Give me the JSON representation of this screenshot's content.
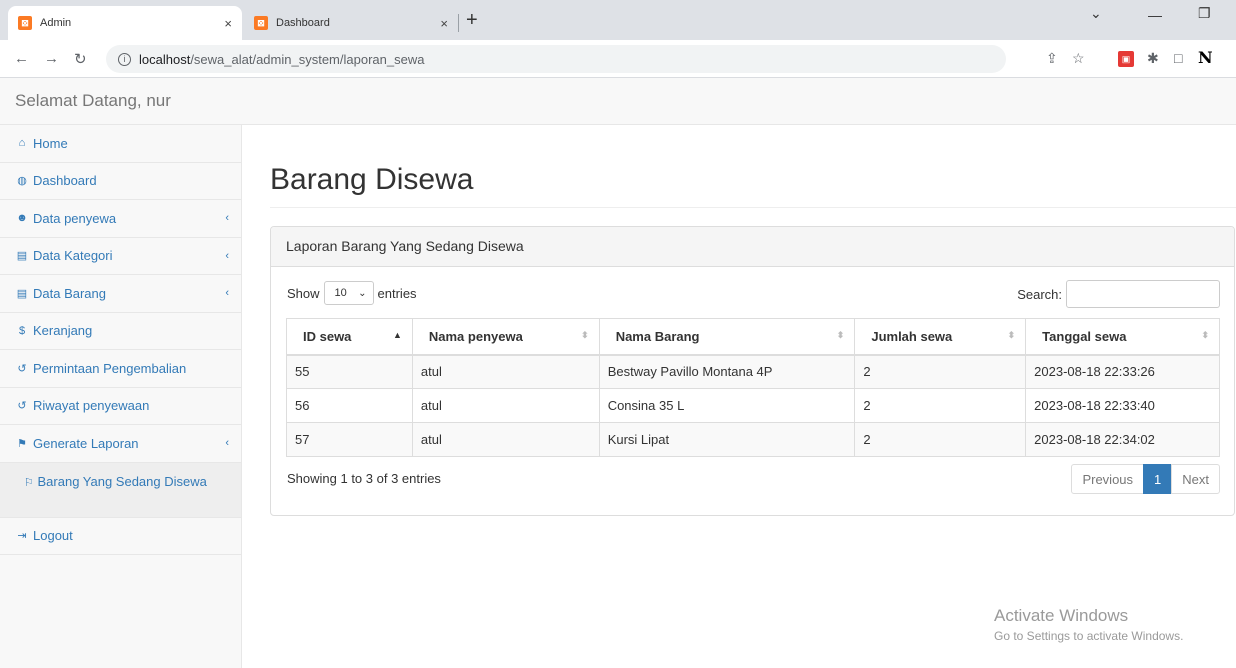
{
  "browser": {
    "tabs": [
      {
        "favicon": "xampp-icon",
        "title": "Admin",
        "close": "×"
      },
      {
        "favicon": "xampp-icon",
        "title": "Dashboard",
        "close": "×"
      }
    ],
    "new_tab": "+",
    "url_host": "localhost",
    "url_path": "/sewa_alat/admin_system/laporan_sewa"
  },
  "header": {
    "brand": "Selamat Datang, nur"
  },
  "sidebar": {
    "items": [
      {
        "icon": "home-icon",
        "label": "Home"
      },
      {
        "icon": "dashboard-icon",
        "label": "Dashboard"
      },
      {
        "icon": "users-icon",
        "label": "Data penyewa",
        "arrow": "‹"
      },
      {
        "icon": "list-icon",
        "label": "Data Kategori",
        "arrow": "‹"
      },
      {
        "icon": "list-icon",
        "label": "Data Barang",
        "arrow": "‹"
      },
      {
        "icon": "dollar-icon",
        "label": "Keranjang"
      },
      {
        "icon": "undo-icon",
        "label": "Permintaan Pengembalian"
      },
      {
        "icon": "undo-icon",
        "label": "Riwayat penyewaan"
      },
      {
        "icon": "flag-icon",
        "label": "Generate Laporan",
        "arrow": "‹"
      }
    ],
    "sub_item": {
      "icon": "flag-outline-icon",
      "label": "Barang Yang Sedang Disewa"
    },
    "logout": {
      "icon": "sign-out-icon",
      "label": "Logout"
    }
  },
  "main": {
    "title": "Barang Disewa",
    "panel_heading": "Laporan Barang Yang Sedang Disewa",
    "show_label": "Show",
    "entries_value": "10",
    "entries_label": "entries",
    "search_label": "Search:",
    "search_value": "",
    "columns": [
      "ID sewa",
      "Nama penyewa",
      "Nama Barang",
      "Jumlah sewa",
      "Tanggal sewa"
    ],
    "rows": [
      [
        "55",
        "atul",
        "Bestway Pavillo Montana 4P",
        "2",
        "2023-08-18 22:33:26"
      ],
      [
        "56",
        "atul",
        "Consina 35 L",
        "2",
        "2023-08-18 22:33:40"
      ],
      [
        "57",
        "atul",
        "Kursi Lipat",
        "2",
        "2023-08-18 22:34:02"
      ]
    ],
    "info": "Showing 1 to 3 of 3 entries",
    "pager": {
      "previous": "Previous",
      "current": "1",
      "next": "Next"
    }
  },
  "watermark": {
    "line1": "Activate Windows",
    "line2": "Go to Settings to activate Windows."
  }
}
